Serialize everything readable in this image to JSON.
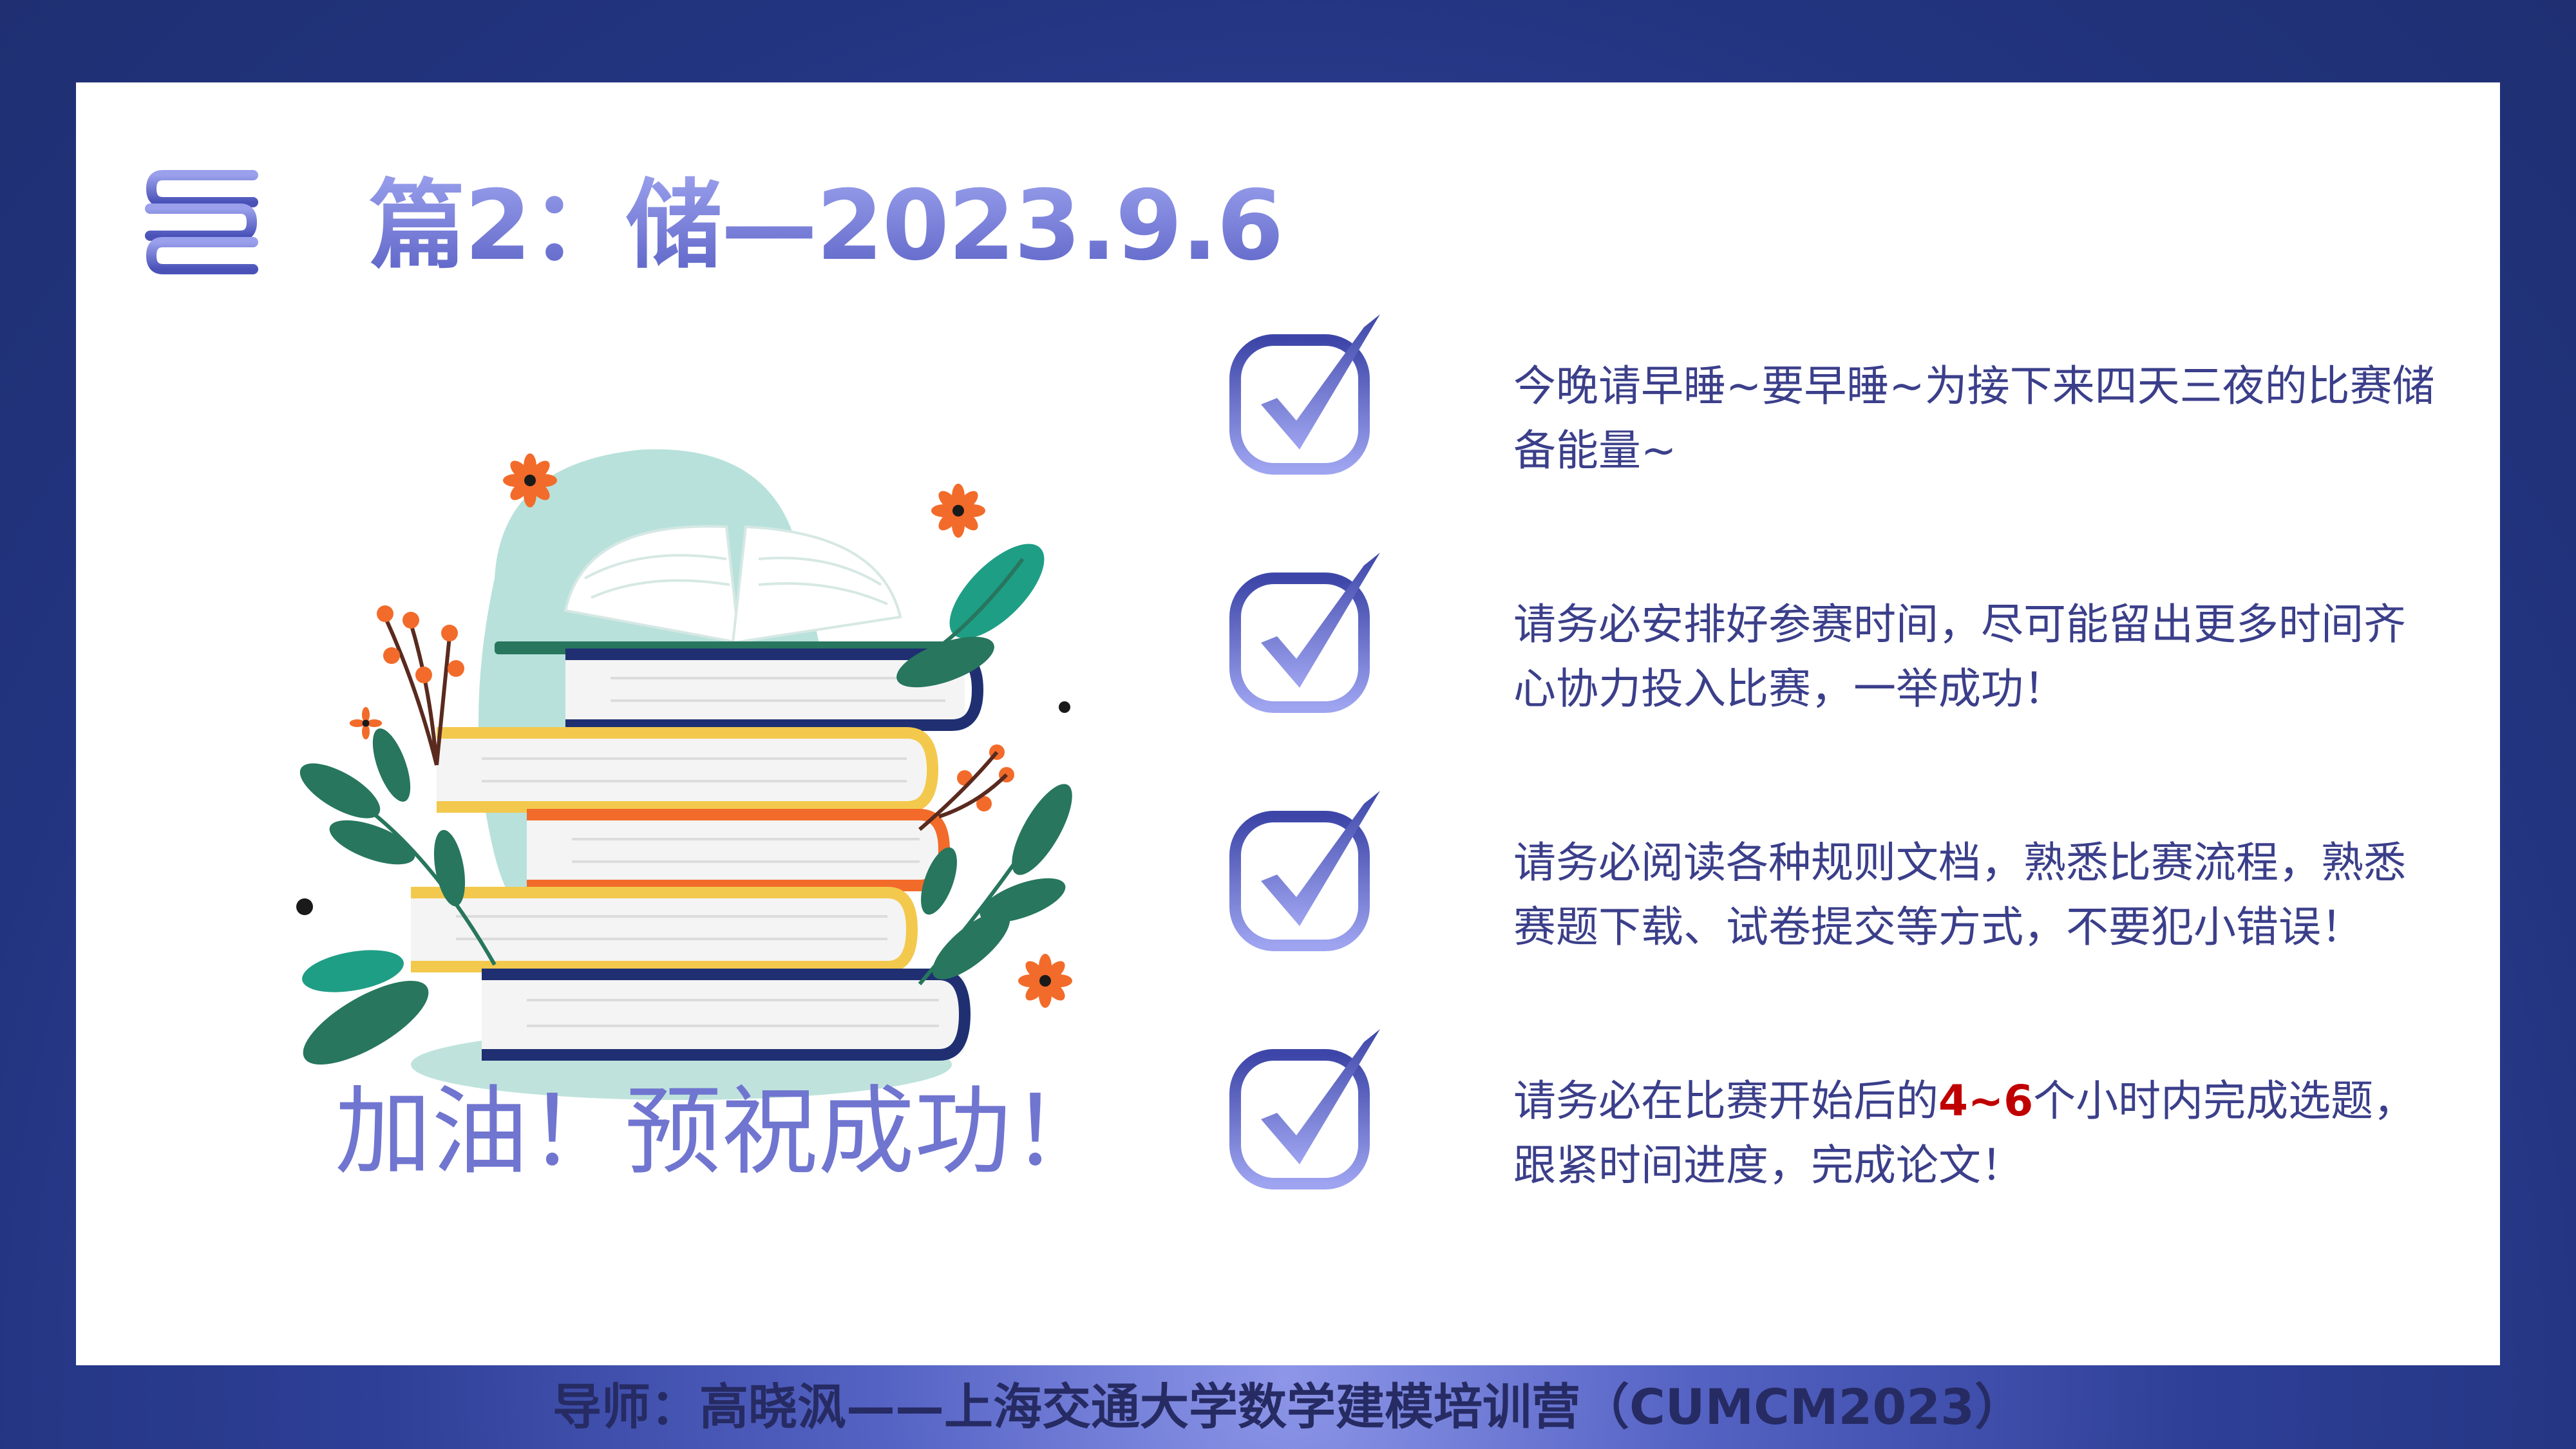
{
  "slide": {
    "title": "篇2：储—2023.9.6",
    "cheer": "加油！预祝成功！",
    "items": [
      {
        "text": "今晚请早睡~要早睡~为接下来四天三夜的比赛储备能量~"
      },
      {
        "text": "请务必安排好参赛时间，尽可能留出更多时间齐心协力投入比赛，一举成功！"
      },
      {
        "text": "请务必阅读各种规则文档，熟悉比赛流程，熟悉赛题下载、试卷提交等方式，不要犯小错误！"
      },
      {
        "text_before": "请务必在比赛开始后的",
        "highlight": "4~6",
        "text_after": "个小时内完成选题，跟紧时间进度，完成论文！"
      }
    ],
    "footer": "导师：高晓沨——上海交通大学数学建模培训营（CUMCM2023）"
  },
  "icons": {
    "title_icon": "stacked-books-icon",
    "item_icon": "checkmark-box-icon",
    "illustration": "book-stack-illustration"
  },
  "colors": {
    "background": "#2b3d90",
    "title_gradient_top": "#9aa0ec",
    "title_gradient_bottom": "#5c63c6",
    "body_text": "#3b3f8a",
    "highlight": "#c00000",
    "cheer_text": "#7075d0"
  }
}
